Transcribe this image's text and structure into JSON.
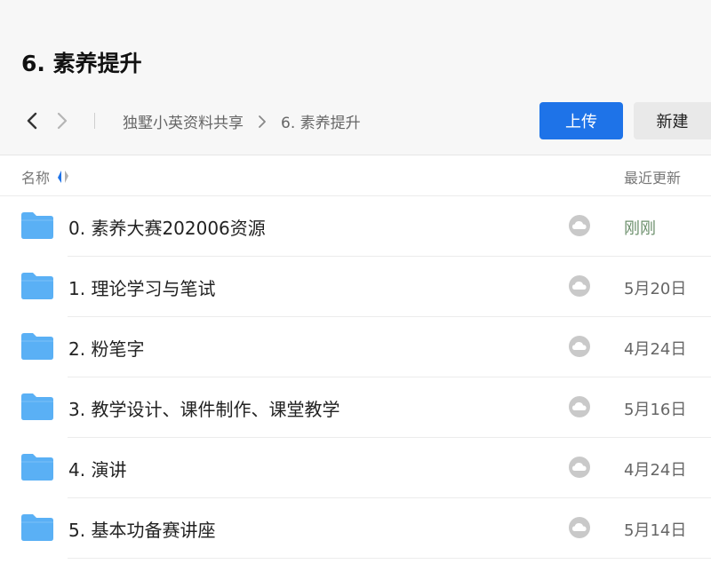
{
  "header": {
    "title": "6. 素养提升",
    "breadcrumb": [
      "独墅小英资料共享",
      "6. 素养提升"
    ],
    "upload_label": "上传",
    "new_label": "新建"
  },
  "columns": {
    "name": "名称",
    "updated": "最近更新"
  },
  "icons": {
    "back": "chevron-left-icon",
    "forward": "chevron-right-icon",
    "sort": "sort-icon",
    "folder": "folder-icon",
    "sync": "cloud-sync-icon"
  },
  "colors": {
    "accent": "#1e73e8",
    "folder": "#5ab0f5",
    "sync_icon": "#c9c9c9"
  },
  "rows": [
    {
      "name": "0. 素养大赛202006资源",
      "updated": "刚刚"
    },
    {
      "name": "1. 理论学习与笔试",
      "updated": "5月20日"
    },
    {
      "name": "2. 粉笔字",
      "updated": "4月24日"
    },
    {
      "name": "3. 教学设计、课件制作、课堂教学",
      "updated": "5月16日"
    },
    {
      "name": "4. 演讲",
      "updated": "4月24日"
    },
    {
      "name": "5. 基本功备赛讲座",
      "updated": "5月14日"
    }
  ]
}
